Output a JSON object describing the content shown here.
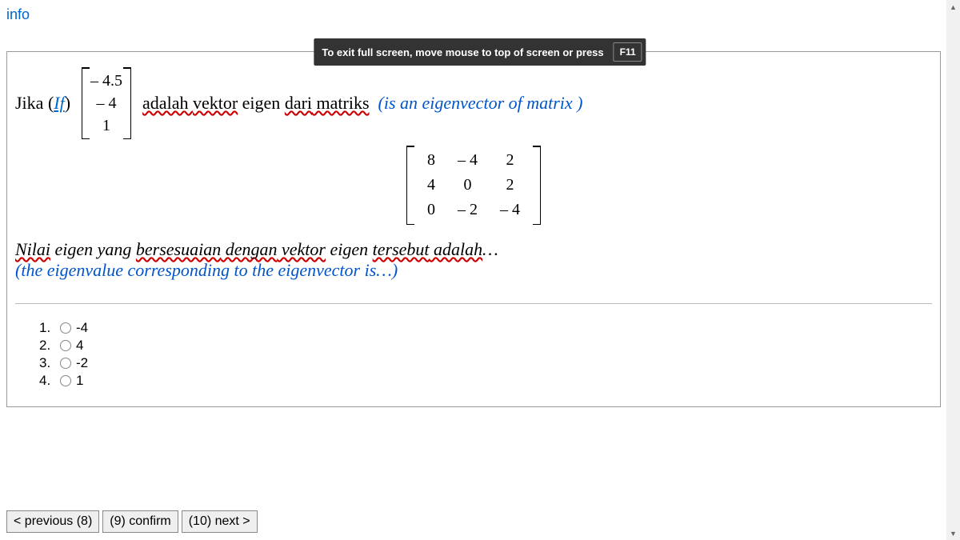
{
  "header": {
    "info_label": "info",
    "fullscreen_text": "To exit full screen, move mouse to top of screen or press",
    "fullscreen_key": "F11"
  },
  "question": {
    "jika": "Jika (",
    "if": "If ",
    "jika_close": ")",
    "vector": [
      "– 4.5",
      "– 4",
      "1"
    ],
    "adalah": "adalah ",
    "vektor_eigen": "vektor",
    "eigen_word": " eigen ",
    "dari": "dari",
    "matriks": " matriks",
    "is_eigen": "(is an eigenvector of matrix )",
    "matrix": [
      [
        "8",
        "– 4",
        "2"
      ],
      [
        "4",
        "0",
        "2"
      ],
      [
        "0",
        "– 2",
        "– 4"
      ]
    ],
    "nilai": "Nilai",
    "eigen_yang": " eigen yang ",
    "bersesuaian": "bersesuaian",
    "dengan": " dengan",
    "vektor2": " vektor",
    "eigen2": " eigen ",
    "tersebut": "tersebut",
    "adalah2": " adalah",
    "ellipsis": "…",
    "translation2": "(the eigenvalue corresponding to the eigenvector is…)",
    "options": [
      {
        "num": "1.",
        "label": "-4"
      },
      {
        "num": "2.",
        "label": "4"
      },
      {
        "num": "3.",
        "label": "-2"
      },
      {
        "num": "4.",
        "label": "1"
      }
    ]
  },
  "nav": {
    "prev": "< previous (8)",
    "confirm": "(9) confirm",
    "next": "(10) next >"
  }
}
